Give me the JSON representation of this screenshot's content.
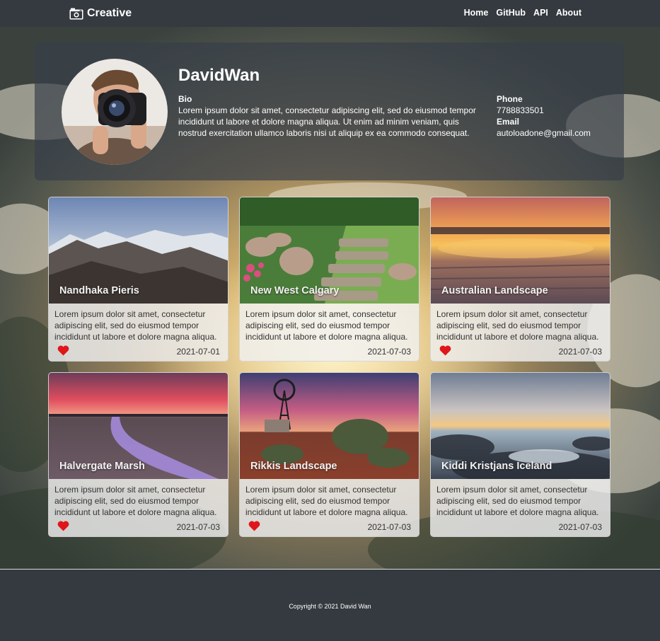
{
  "navbar": {
    "brand": "Creative",
    "links": [
      "Home",
      "GitHub",
      "API",
      "About"
    ]
  },
  "profile": {
    "name": "DavidWan",
    "bio_label": "Bio",
    "bio_text": "Lorem ipsum dolor sit amet, consectetur adipiscing elit, sed do eiusmod tempor incididunt ut labore et dolore magna aliqua. Ut enim ad minim veniam, quis nostrud exercitation ullamco laboris nisi ut aliquip ex ea commodo consequat.",
    "phone_label": "Phone",
    "phone": "7788833501",
    "email_label": "Email",
    "email": "autoloadone@gmail.com"
  },
  "cards": [
    {
      "title": "Nandhaka Pieris",
      "text": "Lorem ipsum dolor sit amet, consectetur adipiscing elit, sed do eiusmod tempor incididunt ut labore et dolore magna aliqua.",
      "date": "2021-07-01",
      "liked": true
    },
    {
      "title": "New West Calgary",
      "text": "Lorem ipsum dolor sit amet, consectetur adipiscing elit, sed do eiusmod tempor incididunt ut labore et dolore magna aliqua.",
      "date": "2021-07-03",
      "liked": false
    },
    {
      "title": "Australian Landscape",
      "text": "Lorem ipsum dolor sit amet, consectetur adipiscing elit, sed do eiusmod tempor incididunt ut labore et dolore magna aliqua.",
      "date": "2021-07-03",
      "liked": true
    },
    {
      "title": "Halvergate Marsh",
      "text": "Lorem ipsum dolor sit amet, consectetur adipiscing elit, sed do eiusmod tempor incididunt ut labore et dolore magna aliqua.",
      "date": "2021-07-03",
      "liked": true
    },
    {
      "title": "Rikkis Landscape",
      "text": "Lorem ipsum dolor sit amet, consectetur adipiscing elit, sed do eiusmod tempor incididunt ut labore et dolore magna aliqua.",
      "date": "2021-07-03",
      "liked": true
    },
    {
      "title": "Kiddi Kristjans Iceland",
      "text": "Lorem ipsum dolor sit amet, consectetur adipiscing elit, sed do eiusmod tempor incididunt ut labore et dolore magna aliqua.",
      "date": "2021-07-03",
      "liked": false
    }
  ],
  "footer": {
    "copyright": "Copyright © 2021 David Wan"
  },
  "colors": {
    "navbar": "#343a40",
    "heart": "#e0161b"
  },
  "icons": {
    "brand": "camera-icon",
    "like": "heart-icon"
  }
}
